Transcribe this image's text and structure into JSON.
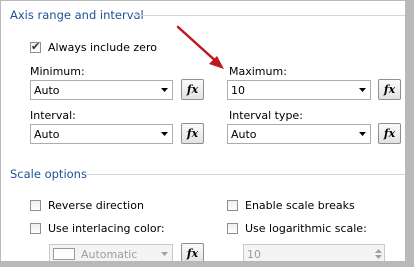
{
  "axis_section": {
    "title": "Axis range and interval"
  },
  "always_zero": {
    "label": "Always include zero",
    "checked": true
  },
  "minimum": {
    "label": "Minimum:",
    "value": "Auto"
  },
  "maximum": {
    "label": "Maximum:",
    "value": "10"
  },
  "interval": {
    "label": "Interval:",
    "value": "Auto"
  },
  "interval_type": {
    "label": "Interval type:",
    "value": "Auto"
  },
  "fx_label": "fx",
  "scale_section": {
    "title": "Scale options"
  },
  "reverse_direction": {
    "label": "Reverse direction",
    "checked": false
  },
  "scale_breaks": {
    "label": "Enable scale breaks",
    "checked": false
  },
  "interlacing": {
    "label": "Use interlacing color:",
    "checked": false
  },
  "interlacing_color": {
    "value": "Automatic"
  },
  "log_scale": {
    "label": "Use logarithmic scale:",
    "checked": false
  },
  "log_base": {
    "value": "10"
  },
  "colors": {
    "accent": "#1f4f9a",
    "annotation_arrow": "#c0181b"
  },
  "icons": {
    "dropdown": "chevron-down-icon",
    "formula": "fx-icon",
    "annotation": "red-arrow-icon"
  }
}
